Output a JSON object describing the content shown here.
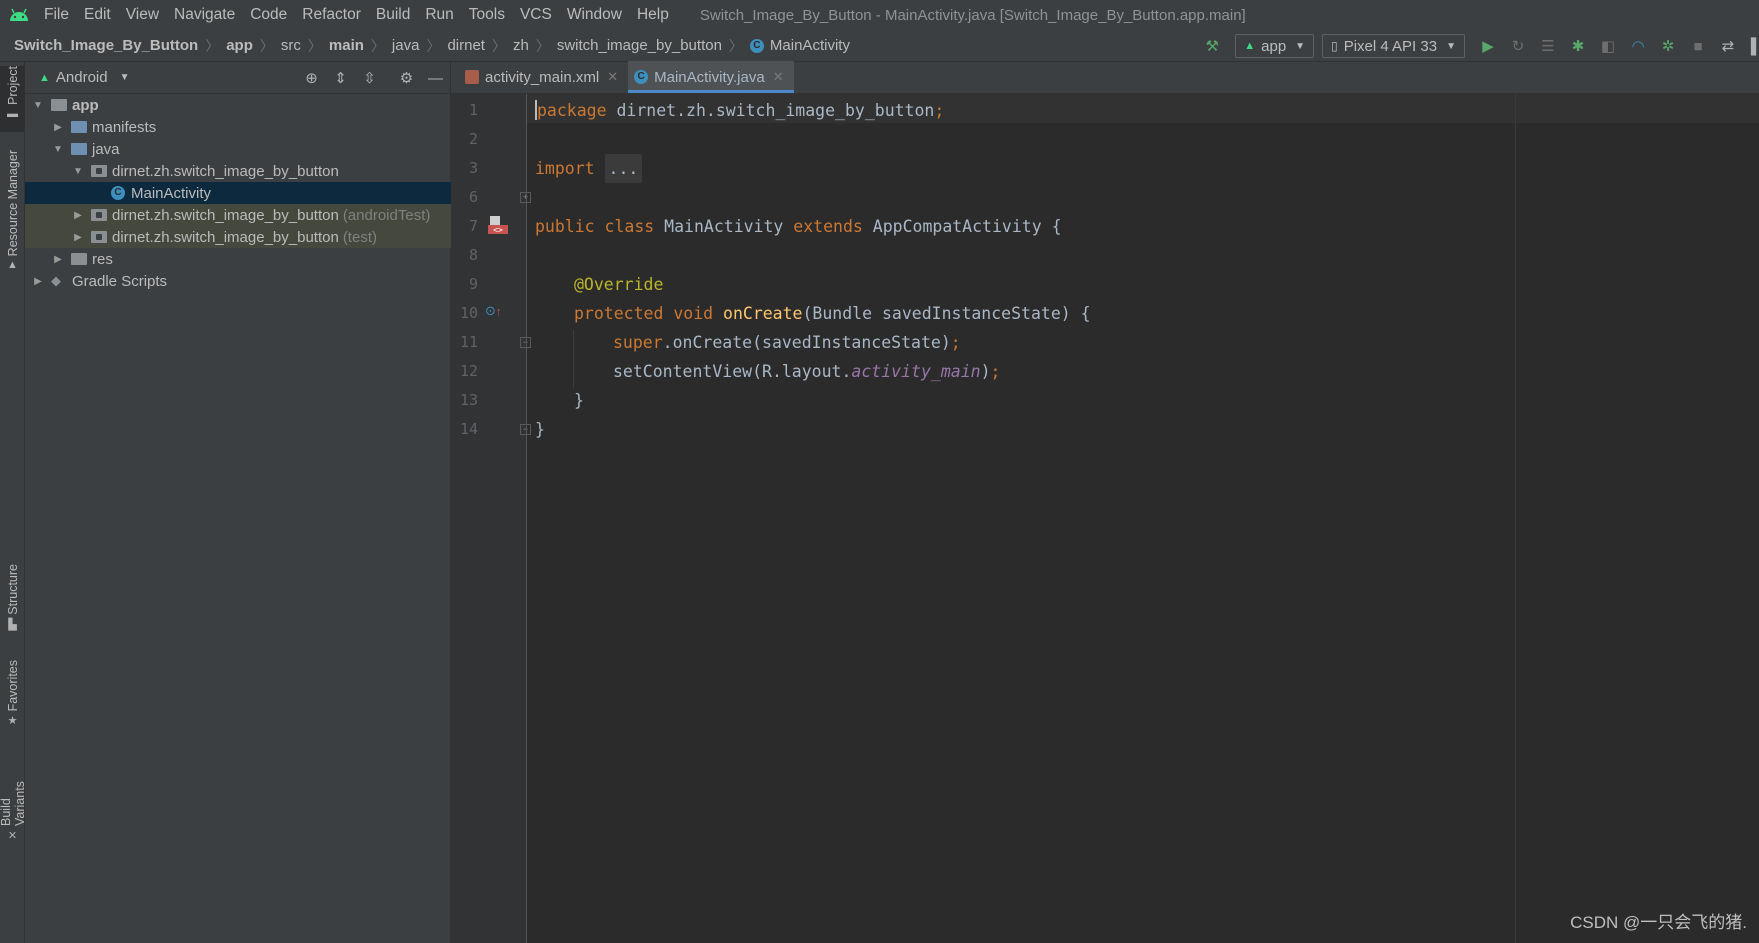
{
  "menubar": {
    "items": [
      "File",
      "Edit",
      "View",
      "Navigate",
      "Code",
      "Refactor",
      "Build",
      "Run",
      "Tools",
      "VCS",
      "Window",
      "Help"
    ],
    "window_title": "Switch_Image_By_Button - MainActivity.java [Switch_Image_By_Button.app.main]"
  },
  "breadcrumbs": [
    "Switch_Image_By_Button",
    "app",
    "src",
    "main",
    "java",
    "dirnet",
    "zh",
    "switch_image_by_button",
    "MainActivity"
  ],
  "toolbar": {
    "run_config": "app",
    "device": "Pixel 4 API 33"
  },
  "left_stripe": [
    "Project",
    "Resource Manager",
    "Structure",
    "Favorites",
    "Build Variants"
  ],
  "project": {
    "view_mode": "Android",
    "tree": [
      {
        "label": "app",
        "bold": true,
        "suffix": ""
      },
      {
        "label": "manifests",
        "suffix": ""
      },
      {
        "label": "java",
        "suffix": ""
      },
      {
        "label": "dirnet.zh.switch_image_by_button",
        "suffix": ""
      },
      {
        "label": "MainActivity",
        "suffix": ""
      },
      {
        "label": "dirnet.zh.switch_image_by_button",
        "suffix": "(androidTest)"
      },
      {
        "label": "dirnet.zh.switch_image_by_button",
        "suffix": "(test)"
      },
      {
        "label": "res",
        "suffix": ""
      },
      {
        "label": "Gradle Scripts",
        "suffix": ""
      }
    ]
  },
  "editor": {
    "tabs": [
      "activity_main.xml",
      "MainActivity.java"
    ],
    "line_numbers": [
      "1",
      "2",
      "3",
      "6",
      "7",
      "8",
      "9",
      "10",
      "11",
      "12",
      "13",
      "14"
    ],
    "code": {
      "l1_kw": "package",
      "l1_rest": " dirnet.zh.switch_image_by_button",
      "semicolon": ";",
      "l3_kw": "import",
      "l3_fold": "...",
      "l7_kw1": "public class",
      "l7_name": " MainActivity ",
      "l7_kw2": "extends",
      "l7_rest": " AppCompatActivity {",
      "l9_ann": "@Override",
      "l10_kw": "protected void",
      "l10_fn": "onCreate",
      "l10_rest": "(Bundle savedInstanceState) {",
      "l11_kw": "super",
      "l11_rest": ".onCreate(savedInstanceState)",
      "l12_a": "setContentView(R.layout.",
      "l12_fld": "activity_main",
      "l12_b": ")",
      "l13": "}",
      "l14": "}"
    }
  },
  "watermark": "CSDN @一只会飞的猪."
}
